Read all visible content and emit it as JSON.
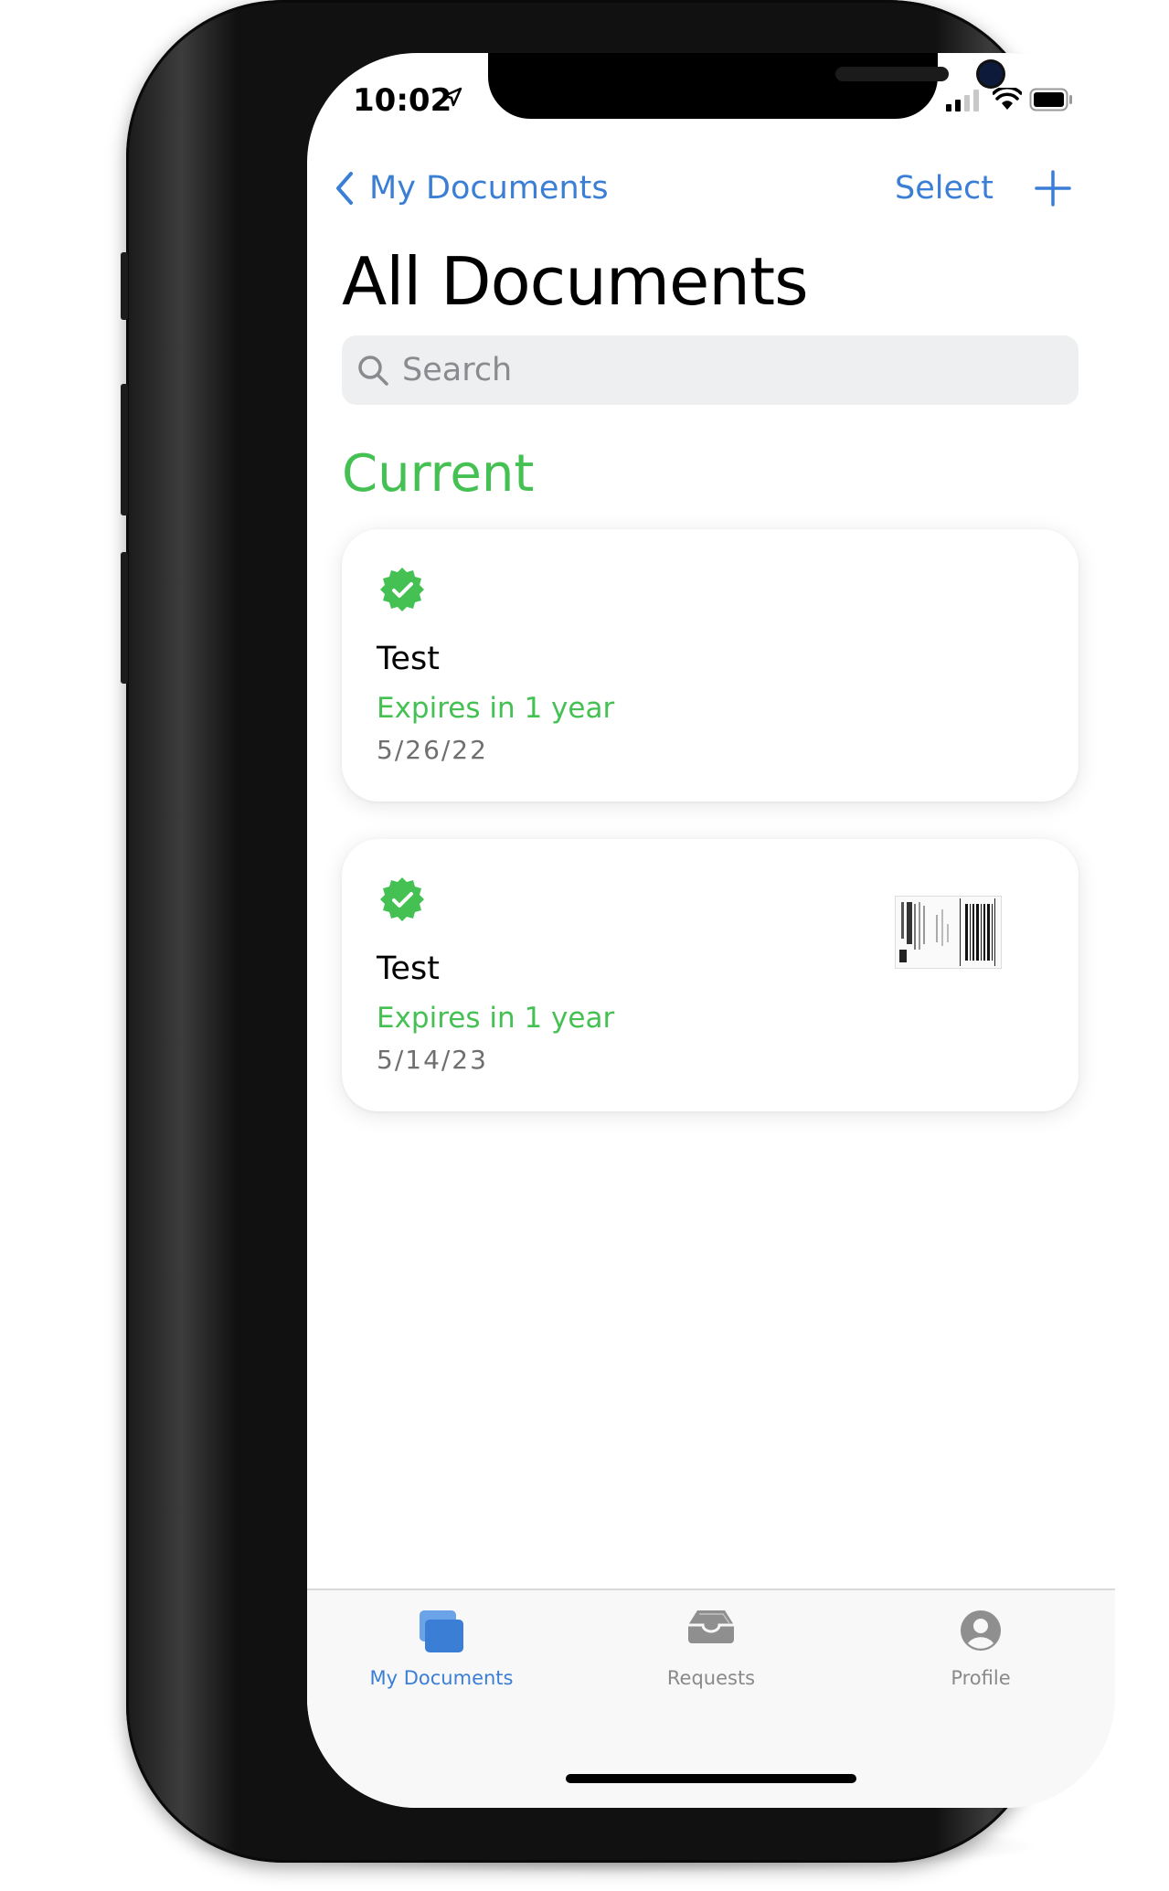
{
  "status_bar": {
    "time": "10:02"
  },
  "nav": {
    "back_label": "My Documents",
    "select_label": "Select"
  },
  "page": {
    "title": "All Documents"
  },
  "search": {
    "placeholder": "Search"
  },
  "section": {
    "title": "Current"
  },
  "documents": [
    {
      "title": "Test",
      "expiry": "Expires in 1 year",
      "date": "5/26/22",
      "has_thumbnail": false
    },
    {
      "title": "Test",
      "expiry": "Expires in 1 year",
      "date": "5/14/23",
      "has_thumbnail": true
    }
  ],
  "tabbar": {
    "tabs": [
      {
        "label": "My Documents",
        "icon": "documents-icon",
        "active": true
      },
      {
        "label": "Requests",
        "icon": "inbox-tray-icon",
        "active": false
      },
      {
        "label": "Profile",
        "icon": "person-circle-icon",
        "active": false
      }
    ]
  },
  "colors": {
    "accent_blue": "#3a7fd5",
    "green": "#45c154",
    "grey_text": "#8a8a8a"
  }
}
